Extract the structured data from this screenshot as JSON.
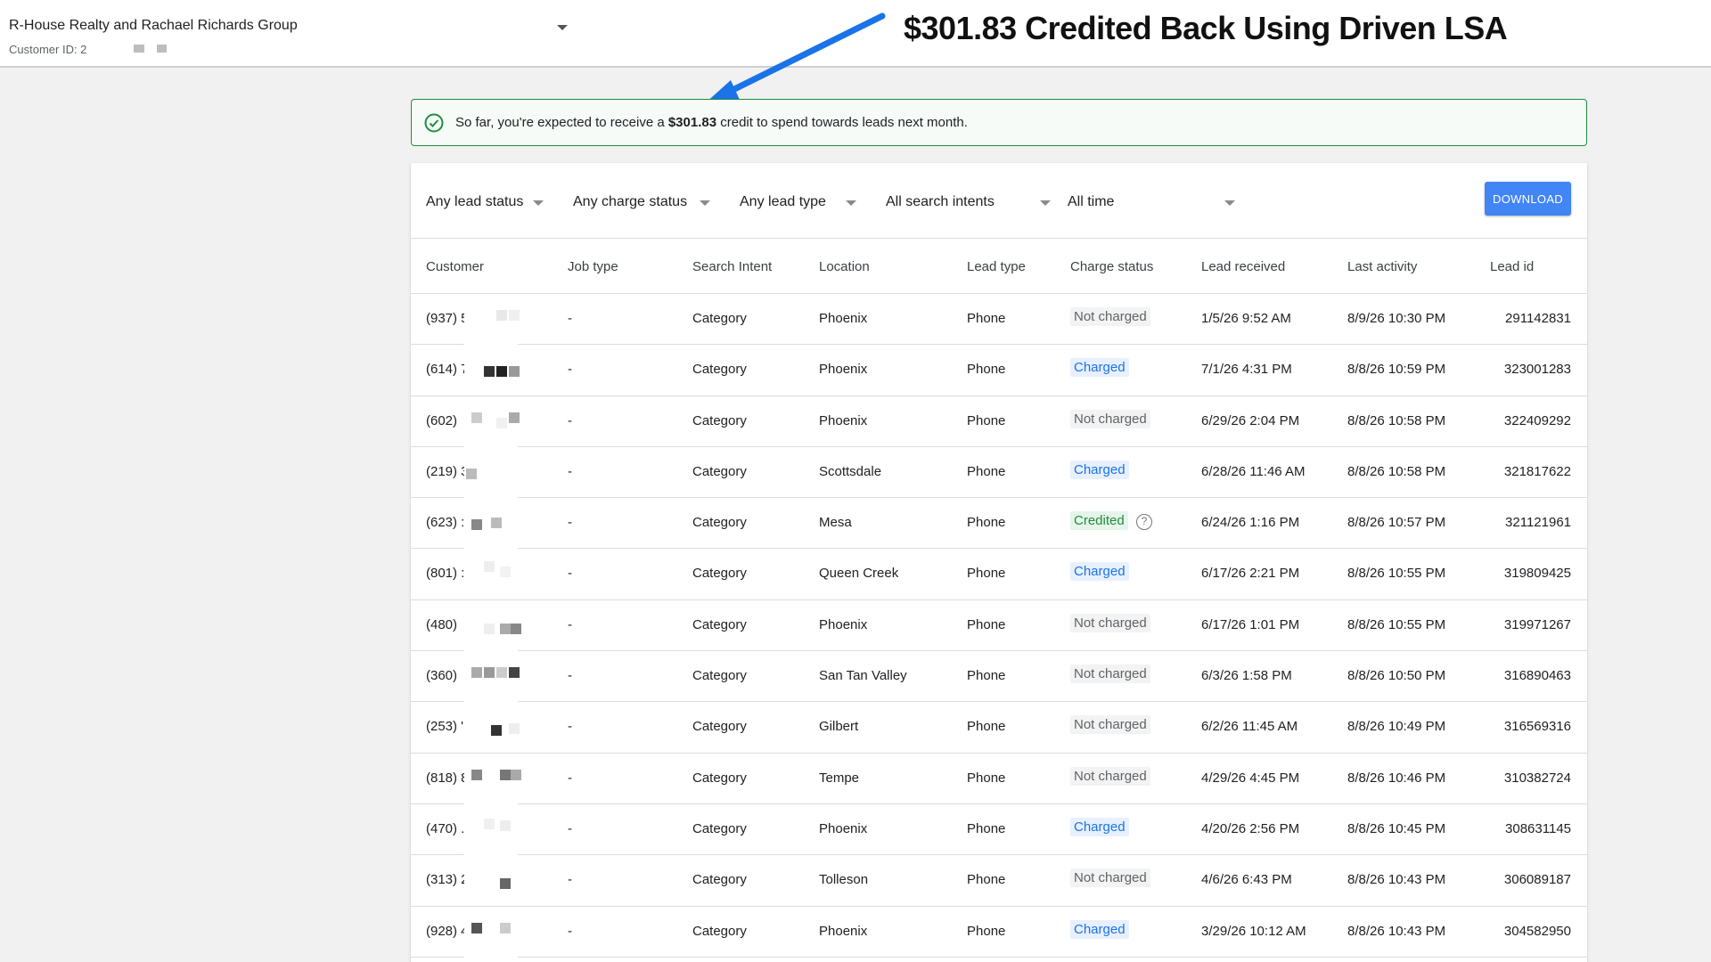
{
  "account": {
    "name": "R-House Realty and Rachael Richards Group",
    "customer_id_label": "Customer ID: 2"
  },
  "headline": "$301.83 Credited Back Using Driven LSA",
  "banner": {
    "text_before": "So far, you're expected to receive a ",
    "amount": "$301.83",
    "text_after": " credit to spend towards leads next month."
  },
  "filters": {
    "lead_status": "Any lead status",
    "charge_status": "Any charge status",
    "lead_type": "Any lead type",
    "search_intents": "All search intents",
    "time": "All time",
    "download_label": "DOWNLOAD"
  },
  "columns": [
    "Customer",
    "Job type",
    "Search Intent",
    "Location",
    "Lead type",
    "Charge status",
    "Lead received",
    "Last activity",
    "Lead id"
  ],
  "rows": [
    {
      "customer": "(937) 5",
      "job_type": "-",
      "intent": "Category",
      "location": "Phoenix",
      "lead_type": "Phone",
      "charge": "Not charged",
      "received": "1/5/26 9:52 AM",
      "activity": "8/9/26 10:30 PM",
      "lead_id": "291142831"
    },
    {
      "customer": "(614) 7",
      "job_type": "-",
      "intent": "Category",
      "location": "Phoenix",
      "lead_type": "Phone",
      "charge": "Charged",
      "received": "7/1/26 4:31 PM",
      "activity": "8/8/26 10:59 PM",
      "lead_id": "323001283"
    },
    {
      "customer": "(602)",
      "job_type": "-",
      "intent": "Category",
      "location": "Phoenix",
      "lead_type": "Phone",
      "charge": "Not charged",
      "received": "6/29/26 2:04 PM",
      "activity": "8/8/26 10:58 PM",
      "lead_id": "322409292"
    },
    {
      "customer": "(219) 3",
      "job_type": "-",
      "intent": "Category",
      "location": "Scottsdale",
      "lead_type": "Phone",
      "charge": "Charged",
      "received": "6/28/26 11:46 AM",
      "activity": "8/8/26 10:58 PM",
      "lead_id": "321817622"
    },
    {
      "customer": "(623) :",
      "job_type": "-",
      "intent": "Category",
      "location": "Mesa",
      "lead_type": "Phone",
      "charge": "Credited",
      "received": "6/24/26 1:16 PM",
      "activity": "8/8/26 10:57 PM",
      "lead_id": "321121961"
    },
    {
      "customer": "(801) :",
      "job_type": "-",
      "intent": "Category",
      "location": "Queen Creek",
      "lead_type": "Phone",
      "charge": "Charged",
      "received": "6/17/26 2:21 PM",
      "activity": "8/8/26 10:55 PM",
      "lead_id": "319809425"
    },
    {
      "customer": "(480)",
      "job_type": "-",
      "intent": "Category",
      "location": "Phoenix",
      "lead_type": "Phone",
      "charge": "Not charged",
      "received": "6/17/26 1:01 PM",
      "activity": "8/8/26 10:55 PM",
      "lead_id": "319971267"
    },
    {
      "customer": "(360)",
      "job_type": "-",
      "intent": "Category",
      "location": "San Tan Valley",
      "lead_type": "Phone",
      "charge": "Not charged",
      "received": "6/3/26 1:58 PM",
      "activity": "8/8/26 10:50 PM",
      "lead_id": "316890463"
    },
    {
      "customer": "(253) '",
      "job_type": "-",
      "intent": "Category",
      "location": "Gilbert",
      "lead_type": "Phone",
      "charge": "Not charged",
      "received": "6/2/26 11:45 AM",
      "activity": "8/8/26 10:49 PM",
      "lead_id": "316569316"
    },
    {
      "customer": "(818) 8",
      "job_type": "-",
      "intent": "Category",
      "location": "Tempe",
      "lead_type": "Phone",
      "charge": "Not charged",
      "received": "4/29/26 4:45 PM",
      "activity": "8/8/26 10:46 PM",
      "lead_id": "310382724"
    },
    {
      "customer": "(470) .",
      "job_type": "-",
      "intent": "Category",
      "location": "Phoenix",
      "lead_type": "Phone",
      "charge": "Charged",
      "received": "4/20/26 2:56 PM",
      "activity": "8/8/26 10:45 PM",
      "lead_id": "308631145"
    },
    {
      "customer": "(313) 2",
      "job_type": "-",
      "intent": "Category",
      "location": "Tolleson",
      "lead_type": "Phone",
      "charge": "Not charged",
      "received": "4/6/26 6:43 PM",
      "activity": "8/8/26 10:43 PM",
      "lead_id": "306089187"
    },
    {
      "customer": "(928) 4",
      "job_type": "-",
      "intent": "Category",
      "location": "Phoenix",
      "lead_type": "Phone",
      "charge": "Charged",
      "received": "3/29/26 10:12 AM",
      "activity": "8/8/26 10:43 PM",
      "lead_id": "304582950"
    }
  ],
  "colors": {
    "accent": "#4285f4",
    "credited": "#1e8e3e",
    "charged": "#1a73e8",
    "arrow": "#1a73e8"
  }
}
